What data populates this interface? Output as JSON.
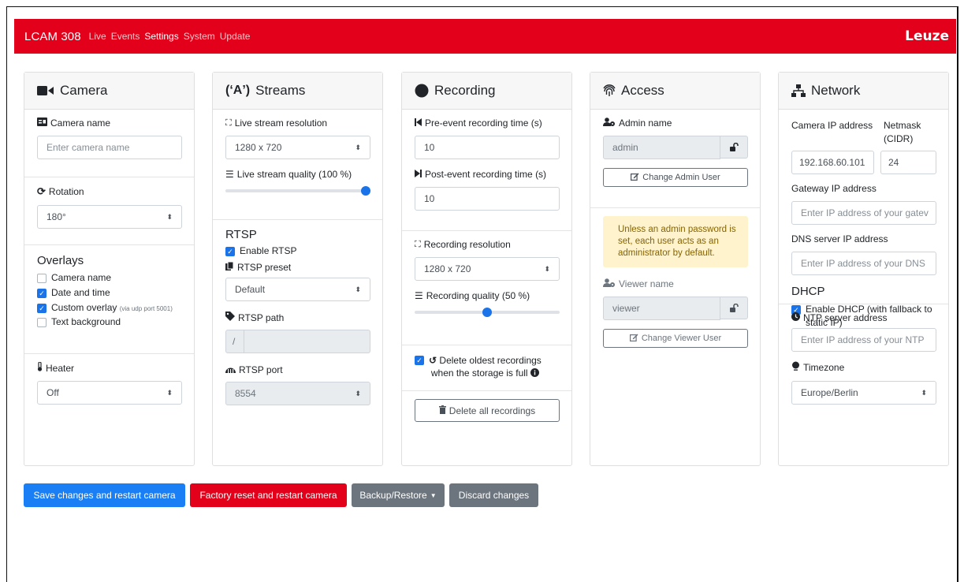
{
  "nav": {
    "brand": "LCAM 308",
    "links": [
      "Live",
      "Events",
      "Settings",
      "System",
      "Update"
    ],
    "logo": "Leuze"
  },
  "camera": {
    "title": "Camera",
    "name_label": "Camera name",
    "name_placeholder": "Enter camera name",
    "rotation_label": "Rotation",
    "rotation_value": "180°",
    "overlays_title": "Overlays",
    "overlay_camera_name": "Camera name",
    "overlay_date_time": "Date and time",
    "overlay_custom": "Custom overlay",
    "overlay_custom_hint": "(via udp port 5001)",
    "overlay_text_bg": "Text background",
    "heater_label": "Heater",
    "heater_value": "Off"
  },
  "streams": {
    "title": "Streams",
    "resolution_label": "Live stream resolution",
    "resolution_value": "1280 x 720",
    "quality_label": "Live stream quality (100 %)",
    "quality_value": 1.0,
    "rtsp_title": "RTSP",
    "enable_rtsp": "Enable RTSP",
    "preset_label": "RTSP preset",
    "preset_value": "Default",
    "path_label": "RTSP path",
    "path_prefix": "/",
    "port_label": "RTSP port",
    "port_value": "8554"
  },
  "recording": {
    "title": "Recording",
    "pre_label": "Pre-event recording time (s)",
    "pre_value": "10",
    "post_label": "Post-event recording time (s)",
    "post_value": "10",
    "resolution_label": "Recording resolution",
    "resolution_value": "1280 x 720",
    "quality_label": "Recording quality (50 %)",
    "quality_value": 0.5,
    "delete_oldest_line1": "Delete oldest recordings",
    "delete_oldest_line2": "when the storage is full",
    "delete_all": "Delete all recordings"
  },
  "access": {
    "title": "Access",
    "admin_label": "Admin name",
    "admin_value": "admin",
    "change_admin": "Change Admin User",
    "alert": "Unless an admin password is set, each user acts as an administrator by default.",
    "viewer_label": "Viewer name",
    "viewer_value": "viewer",
    "change_viewer": "Change Viewer User"
  },
  "network": {
    "title": "Network",
    "ip_label": "Camera IP address",
    "ip_value": "192.168.60.101",
    "netmask_label": "Netmask (CIDR)",
    "netmask_value": "24",
    "gateway_label": "Gateway IP address",
    "gateway_placeholder": "Enter IP address of your gatev",
    "dns_label": "DNS server IP address",
    "dns_placeholder": "Enter IP address of your DNS",
    "dhcp_title": "DHCP",
    "dhcp_enable": "Enable DHCP (with fallback to static IP)",
    "ntp_label": "NTP server address",
    "ntp_placeholder": "Enter IP address of your NTP",
    "timezone_label": "Timezone",
    "timezone_value": "Europe/Berlin"
  },
  "actions": {
    "save": "Save changes and restart camera",
    "factory": "Factory reset and restart camera",
    "backup": "Backup/Restore",
    "discard": "Discard changes"
  },
  "colors": {
    "brand_red": "#e2001a",
    "primary_blue": "#1a7ff5",
    "secondary_gray": "#6c757d"
  }
}
